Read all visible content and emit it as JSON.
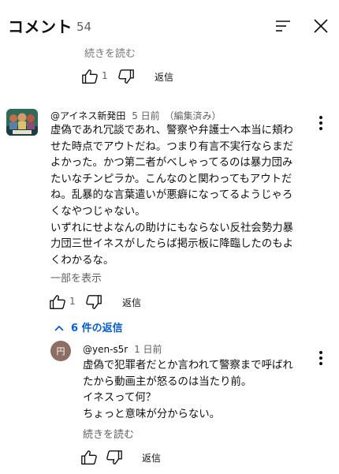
{
  "header": {
    "title": "コメント",
    "count": "54"
  },
  "prev_comment": {
    "read_more": "続きを読む",
    "likes": "1",
    "reply_label": "返信"
  },
  "comment": {
    "author": "@アイネス新発田",
    "time": "5 日前",
    "edited": "（編集済み）",
    "lines": [
      "虚偽であれ冗談であれ、警察や弁護士へ本当に頬わ",
      "せた時点でアウトだね。つまり有言不実行ならまだ",
      "よかった。かつ第二者がべしゃってるのは暴力団み",
      "たいなチンピラか。こんなのと関わってもアウトだ",
      "ね。乱暴的な言葉遣いが悪癖になってるようじゃろ",
      "くなやつじゃない。",
      "いずれにせよなんの助けにもならない反社会勢力暴",
      "力団三世イネスがしたらば掲示板に降臨したのもよ",
      "くわかるな。"
    ],
    "show_more": "一部を表示",
    "likes": "1",
    "reply_label": "返信",
    "replies_toggle": "6 件の返信"
  },
  "reply": {
    "avatar_text": "円",
    "author": "@yen-s5r",
    "time": "1 日前",
    "lines": [
      "虚偽で犯罪者だとか言われて警察まで呼ばれ",
      "たから動画主が怒るのは当たり前。",
      "イネスって何？",
      "ちょっと意味が分からない。"
    ],
    "read_more": "続きを読む",
    "reply_label": "返信"
  }
}
